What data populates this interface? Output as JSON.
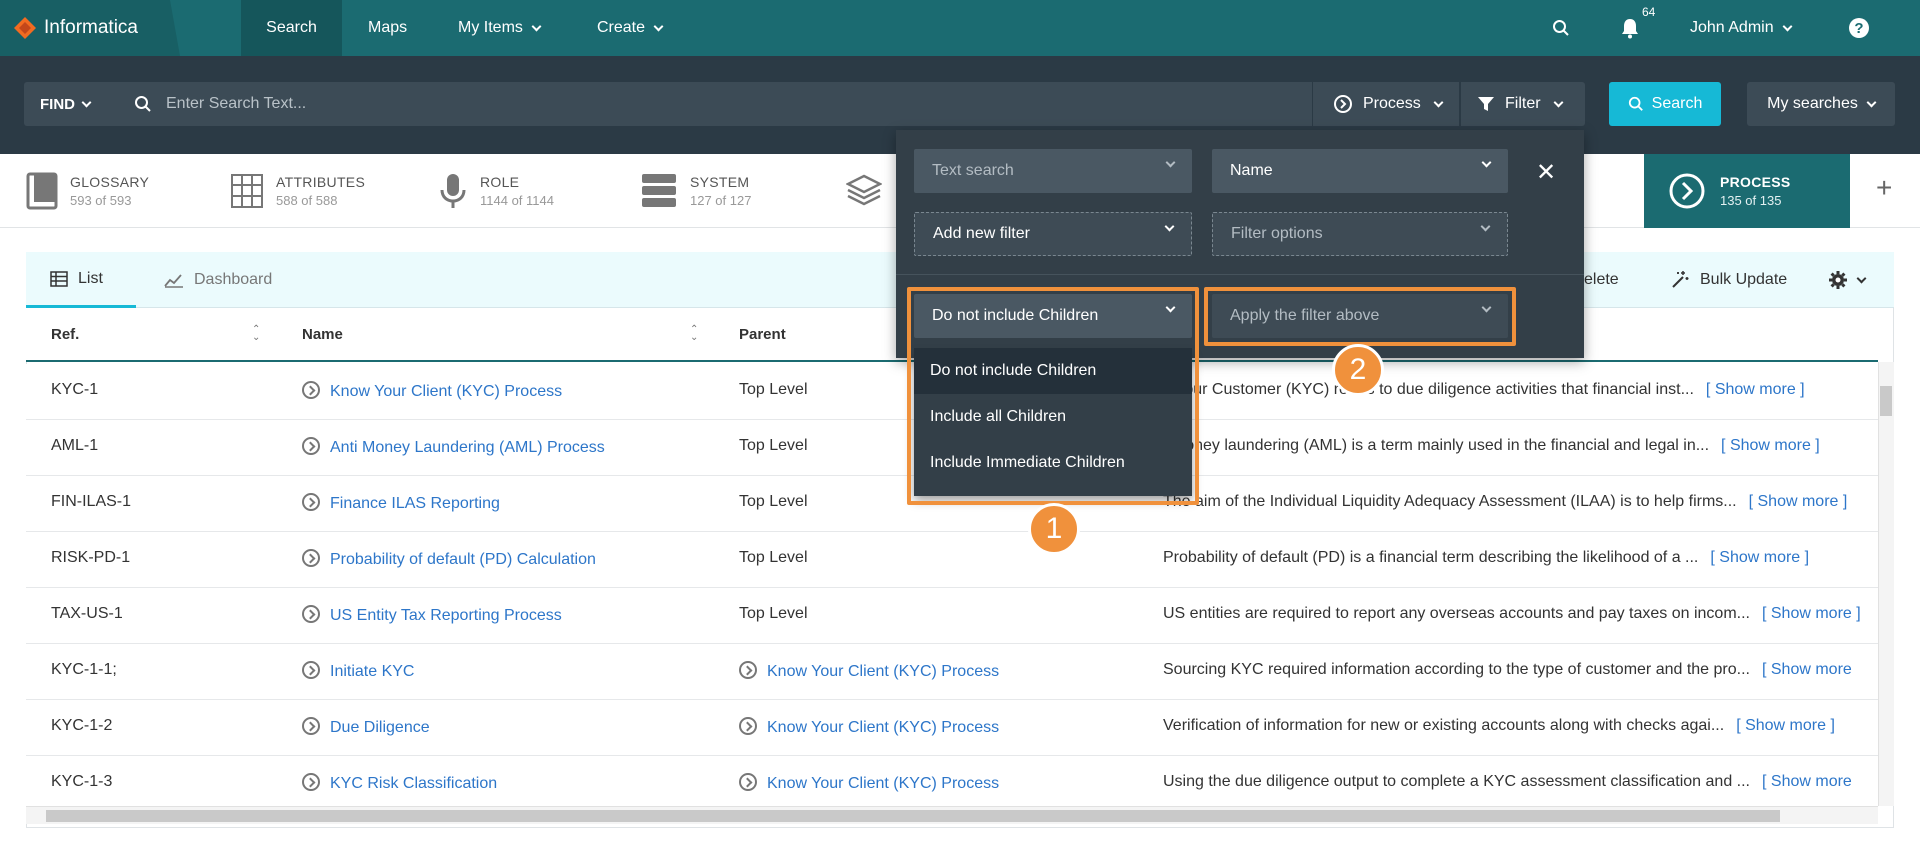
{
  "brand": {
    "name": "Informatica"
  },
  "nav": {
    "search": "Search",
    "maps": "Maps",
    "my_items": "My Items",
    "create": "Create",
    "notif_count": "64",
    "user": "John Admin",
    "help": "?"
  },
  "searchbar": {
    "find": "FIND",
    "placeholder": "Enter Search Text...",
    "process": "Process",
    "filter": "Filter",
    "search_btn": "Search",
    "my_searches": "My searches"
  },
  "categories": [
    {
      "title": "GLOSSARY",
      "count": "593 of 593"
    },
    {
      "title": "ATTRIBUTES",
      "count": "588 of 588"
    },
    {
      "title": "ROLE",
      "count": "1144 of 1144"
    },
    {
      "title": "SYSTEM",
      "count": "127 of 127"
    },
    {
      "title": "PROCESS",
      "count": "135 of 135"
    }
  ],
  "tabs": {
    "list": "List",
    "dashboard": "Dashboard"
  },
  "tools": {
    "delete": "elete",
    "bulk_update": "Bulk Update"
  },
  "columns": {
    "ref": "Ref.",
    "name": "Name",
    "parent": "Parent"
  },
  "rows": [
    {
      "ref": "KYC-1",
      "name": "Know Your Client (KYC) Process",
      "parent": "Top Level",
      "parent_link": false,
      "desc": "v Your Customer (KYC) refers to due diligence activities that financial inst...",
      "more": "[ Show more ]"
    },
    {
      "ref": "AML-1",
      "name": "Anti Money Laundering (AML) Process",
      "parent": "Top Level",
      "parent_link": false,
      "desc": "i-money laundering (AML) is a term mainly used in the financial and legal in...",
      "more": "[ Show more ]"
    },
    {
      "ref": "FIN-ILAS-1",
      "name": "Finance ILAS Reporting",
      "parent": "Top Level",
      "parent_link": false,
      "desc": "The aim of the Individual Liquidity Adequacy Assessment (ILAA) is to help firms...",
      "more": "[ Show more ]"
    },
    {
      "ref": "RISK-PD-1",
      "name": "Probability of default (PD) Calculation",
      "parent": "Top Level",
      "parent_link": false,
      "desc": "Probability of default (PD) is a financial term describing the likelihood of a ...",
      "more": "[ Show more ]"
    },
    {
      "ref": "TAX-US-1",
      "name": "US Entity Tax Reporting Process",
      "parent": "Top Level",
      "parent_link": false,
      "desc": "US entities are required to report any overseas accounts and pay taxes on incom...",
      "more": "[ Show more ]"
    },
    {
      "ref": "KYC-1-1;",
      "name": "Initiate KYC",
      "parent": "Know Your Client (KYC) Process",
      "parent_link": true,
      "desc": "Sourcing KYC required information according to the type of customer and the pro...",
      "more": "[ Show more"
    },
    {
      "ref": "KYC-1-2",
      "name": "Due Diligence",
      "parent": "Know Your Client (KYC) Process",
      "parent_link": true,
      "desc": "Verification of information for new or existing accounts along with checks agai...",
      "more": "[ Show more ]"
    },
    {
      "ref": "KYC-1-3",
      "name": "KYC Risk Classification",
      "parent": "Know Your Client (KYC) Process",
      "parent_link": true,
      "desc": "Using the due diligence output to complete a KYC assessment classification and ...",
      "more": "[ Show more"
    }
  ],
  "filter_panel": {
    "text_search": "Text search",
    "name": "Name",
    "add_filter": "Add new filter",
    "filter_options": "Filter options",
    "children_select": "Do not include Children",
    "apply_select": "Apply the filter above",
    "options": [
      "Do not include Children",
      "Include all Children",
      "Include Immediate Children"
    ]
  },
  "callouts": {
    "one": "1",
    "two": "2"
  },
  "colors": {
    "nav": "#1b6b71",
    "accent": "#16b9d6",
    "highlight": "#f0913c",
    "link": "#2d76c9"
  }
}
